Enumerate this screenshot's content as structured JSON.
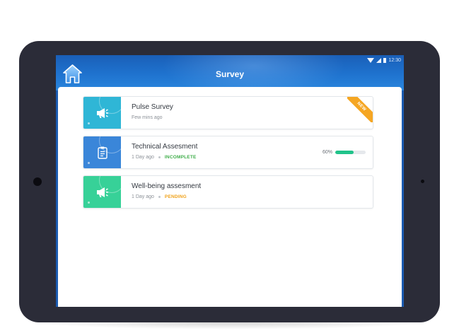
{
  "device": {
    "status_time": "12:30"
  },
  "appbar": {
    "title": "Survey",
    "color": "#1f73cf"
  },
  "surveys": [
    {
      "title": "Pulse Survey",
      "time": "Few mins ago",
      "badge": "NEW",
      "icon": "megaphone-icon",
      "color": "#2fb6d6"
    },
    {
      "title": "Technical Assesment",
      "time": "1 Day ago",
      "status": "INCOMPLETE",
      "status_color": "#3fae4a",
      "progress_label": "60%",
      "progress": 0.6,
      "icon": "clipboard-icon",
      "color": "#3a86d9"
    },
    {
      "title": "Well-being assesment",
      "time": "1 Day ago",
      "status": "PENDING",
      "status_color": "#f0a21a",
      "icon": "megaphone-icon",
      "color": "#37d198"
    }
  ]
}
